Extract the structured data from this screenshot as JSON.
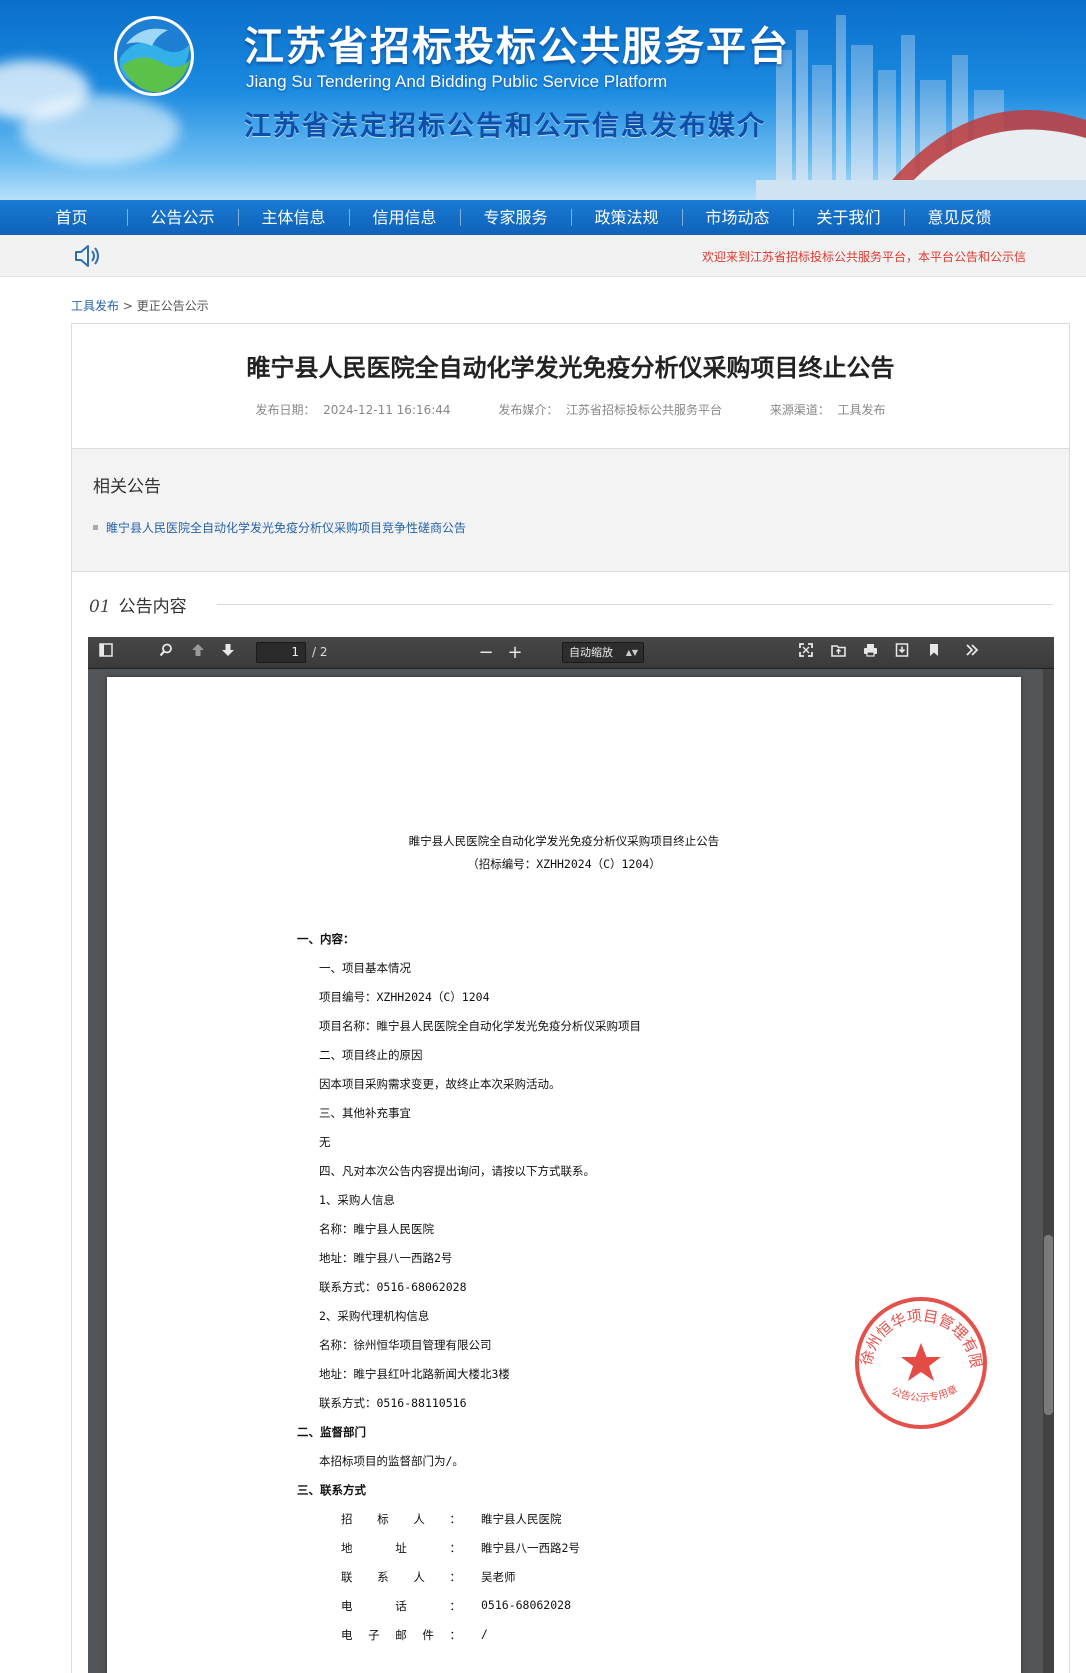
{
  "site": {
    "title": "江苏省招标投标公共服务平台",
    "title_en": "Jiang Su Tendering And Bidding Public Service Platform",
    "slogan": "江苏省法定招标公告和公示信息发布媒介"
  },
  "nav": {
    "items": [
      {
        "label": "首页"
      },
      {
        "label": "公告公示"
      },
      {
        "label": "主体信息"
      },
      {
        "label": "信用信息"
      },
      {
        "label": "专家服务"
      },
      {
        "label": "政策法规"
      },
      {
        "label": "市场动态"
      },
      {
        "label": "关于我们"
      },
      {
        "label": "意见反馈"
      }
    ]
  },
  "notice": {
    "text": "欢迎来到江苏省招标投标公共服务平台，本平台公告和公示信"
  },
  "breadcrumb": {
    "root": "工具发布",
    "separator": ">",
    "current": "更正公告公示"
  },
  "article": {
    "title": "睢宁县人民医院全自动化学发光免疫分析仪采购项目终止公告",
    "meta": {
      "date_label": "发布日期：",
      "date": "2024-12-11 16:16:44",
      "media_label": "发布媒介：",
      "media": "江苏省招标投标公共服务平台",
      "source_label": "来源渠道：",
      "source": "工具发布"
    },
    "related": {
      "heading": "相关公告",
      "items": [
        {
          "label": "睢宁县人民医院全自动化学发光免疫分析仪采购项目竞争性磋商公告"
        }
      ]
    },
    "section": {
      "number": "01",
      "label": "公告内容"
    }
  },
  "viewer": {
    "page_current": "1",
    "page_total": "/ 2",
    "zoom": "自动缩放",
    "zoom_out": "−",
    "zoom_in": "+"
  },
  "pdf": {
    "title": "睢宁县人民医院全自动化学发光免疫分析仪采购项目终止公告",
    "subtitle": "（招标编号：XZHH2024（C）1204）",
    "lines": {
      "h1": "一、内容：",
      "s1": "一、项目基本情况",
      "l1": "项目编号：XZHH2024（C）1204",
      "l2": "项目名称：睢宁县人民医院全自动化学发光免疫分析仪采购项目",
      "s2": "二、项目终止的原因",
      "l3": "因本项目采购需求变更，故终止本次采购活动。",
      "s3": "三、其他补充事宜",
      "l4": "无",
      "s4": "四、凡对本次公告内容提出询问，请按以下方式联系。",
      "l5": "1、采购人信息",
      "l6": "名称：睢宁县人民医院",
      "l7": "地址：睢宁县八一西路2号",
      "l8": "联系方式：0516-68062028",
      "l9": "2、采购代理机构信息",
      "l10": "名称：徐州恒华项目管理有限公司",
      "l11": "地址：睢宁县红叶北路新闻大楼北3楼",
      "l12": "联系方式：0516-88110516",
      "h2": "二、监督部门",
      "l13": "本招标项目的监督部门为/。",
      "h3": "三、联系方式"
    },
    "contacts": [
      {
        "label": "招标人：",
        "value": "睢宁县人民医院"
      },
      {
        "label": "地址：",
        "value": "睢宁县八一西路2号"
      },
      {
        "label": "联系人：",
        "value": "吴老师"
      },
      {
        "label": "电话：",
        "value": "0516-68062028"
      },
      {
        "label": "电子邮件：",
        "value": "/"
      }
    ],
    "seal_text": "徐州恒华项目管理有限公司",
    "seal_sub": "公告公示专用章"
  },
  "colors": {
    "nav_bg": "#0e62b8",
    "link": "#2563a8",
    "notice_text": "#e03a2f",
    "seal_red": "#e0322a"
  }
}
